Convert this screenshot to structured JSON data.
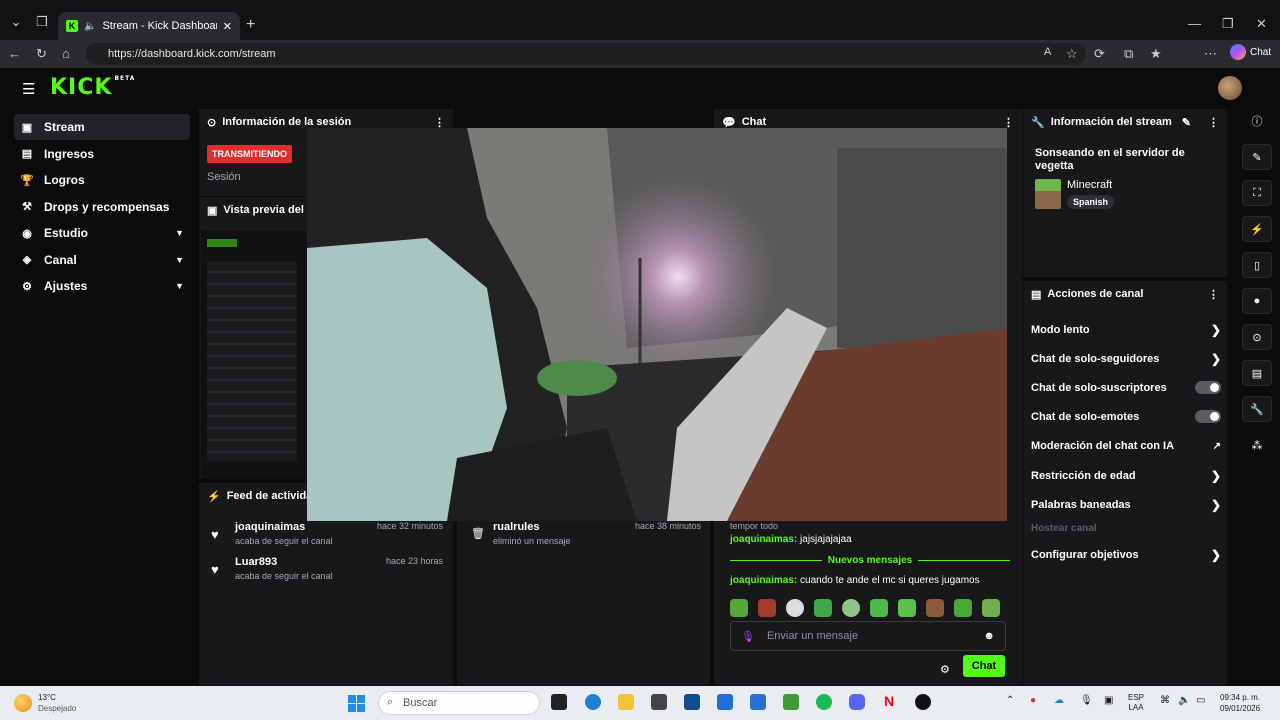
{
  "browser": {
    "tab_title": "Stream - Kick Dashboard",
    "url": "https://dashboard.kick.com/stream",
    "chat_label": "Chat"
  },
  "header": {
    "logo": "KICK",
    "logo_badge": "BETA"
  },
  "sidebar": {
    "items": [
      {
        "label": "Stream",
        "icon": "video-icon"
      },
      {
        "label": "Ingresos",
        "icon": "chart-icon"
      },
      {
        "label": "Logros",
        "icon": "trophy-icon"
      },
      {
        "label": "Drops y recompensas",
        "icon": "gift-icon"
      },
      {
        "label": "Estudio",
        "icon": "gamepad-icon"
      },
      {
        "label": "Canal",
        "icon": "controller-icon"
      },
      {
        "label": "Ajustes",
        "icon": "gear-icon"
      }
    ]
  },
  "session_panel": {
    "title": "Información de la sesión",
    "live_badge": "TRANSMITIENDO",
    "session_label": "Sesión"
  },
  "preview_panel": {
    "title": "Vista previa del s"
  },
  "chat_panel": {
    "title": "Chat",
    "partial_message": "tempor todo",
    "messages": [
      {
        "user": "joaquinaimas:",
        "text": "jajsjajajajaa"
      },
      {
        "user": "joaquinaimas:",
        "text": "cuando te ande el mc si queres jugamos"
      }
    ],
    "new_messages_label": "Nuevos mensajes",
    "input_placeholder": "Enviar un mensaje",
    "send_button": "Chat"
  },
  "feed_panel": {
    "title": "Feed de activida",
    "items": [
      {
        "user": "joaquinaimas",
        "action": "acaba de seguir el canal",
        "time": "hace 32 minutos"
      },
      {
        "user": "Luar893",
        "action": "acaba de seguir el canal",
        "time": "hace 23 horas"
      }
    ]
  },
  "mod_panel": {
    "items": [
      {
        "user": "rualrules",
        "action": "eliminó un mensaje",
        "time": "hace 38 minutos"
      }
    ]
  },
  "stream_info": {
    "title": "Información del stream",
    "stream_title": "Sonseando en el servidor de vegetta",
    "category": "Minecraft",
    "language_tag": "Spanish"
  },
  "channel_actions": {
    "title": "Acciones de canal",
    "items": [
      {
        "label": "Modo lento",
        "control": "chevron"
      },
      {
        "label": "Chat de solo-seguidores",
        "control": "chevron"
      },
      {
        "label": "Chat de solo-suscriptores",
        "control": "toggle"
      },
      {
        "label": "Chat de solo-emotes",
        "control": "toggle"
      },
      {
        "label": "Moderación del chat con IA",
        "control": "external"
      },
      {
        "label": "Restricción de edad",
        "control": "chevron"
      },
      {
        "label": "Palabras baneadas",
        "control": "chevron"
      },
      {
        "label": "Hostear canal",
        "control": "none",
        "disabled": true
      },
      {
        "label": "Configurar objetivos",
        "control": "chevron"
      }
    ]
  },
  "taskbar": {
    "weather_temp": "13°C",
    "weather_desc": "Despejado",
    "search_placeholder": "Buscar",
    "lang": "ESP",
    "lang2": "LAA",
    "time": "09:34 p. m.",
    "date": "09/01/2026"
  },
  "colors": {
    "brand": "#53fc18",
    "live": "#e02e2e",
    "panel": "#18181b"
  }
}
